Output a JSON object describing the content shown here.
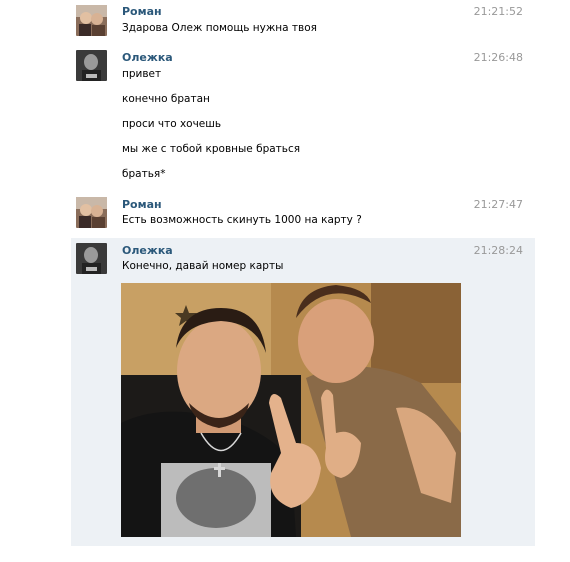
{
  "messages": [
    {
      "author": "Роман",
      "time": "21:21:52",
      "avatar": "roman-avatar",
      "lines": [
        "Здарова Олеж помощь нужна твоя"
      ]
    },
    {
      "author": "Олежка",
      "time": "21:26:48",
      "avatar": "olezhka-avatar",
      "lines": [
        "привет",
        "конечно братан",
        "проси что хочешь",
        "мы же с тобой кровные браться",
        "братья*"
      ]
    },
    {
      "author": "Роман",
      "time": "21:27:47",
      "avatar": "roman-avatar",
      "lines": [
        "Есть возможность скинуть 1000 на карту ?"
      ]
    },
    {
      "author": "Олежка",
      "time": "21:28:24",
      "avatar": "olezhka-avatar",
      "lines": [
        "Конечно, давай номер карты"
      ],
      "attachment": "photo"
    }
  ],
  "colors": {
    "author": "#2b587a",
    "time": "#999999",
    "highlight": "#edf1f5"
  }
}
